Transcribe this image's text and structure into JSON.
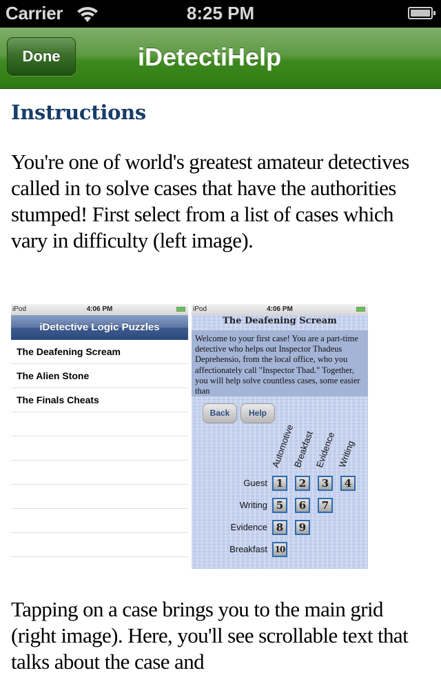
{
  "status_bar": {
    "carrier": "Carrier",
    "time": "8:25 PM",
    "wifi_icon": "wifi-icon",
    "battery_icon": "battery-icon"
  },
  "nav": {
    "done_label": "Done",
    "title": "iDetectiHelp"
  },
  "content": {
    "heading": "Instructions",
    "paragraph1": "You're one of world's greatest amateur detectives called in to solve cases that have the authorities stumped! First select from a list of cases which vary in difficulty (left image).",
    "paragraph2": "Tapping on a case brings you to the main grid (right image). Here, you'll see scrollable text that talks about the case and"
  },
  "left_image": {
    "status": {
      "carrier": "iPod",
      "time": "4:06 PM"
    },
    "title": "iDetective Logic Puzzles",
    "cases": [
      "The Deafening Scream",
      "The Alien Stone",
      "The Finals Cheats"
    ],
    "empty_rows": 6
  },
  "right_image": {
    "status": {
      "carrier": "iPod",
      "time": "4:06 PM"
    },
    "case_title": "The Deafening Scream",
    "case_text": "Welcome to your first case! You are a part-time detective who helps out Inspector Thadeus Deprehensio, from the local office, who you affectionately call \"Inspector Thad.\" Together, you will help solve countless cases, some easier than",
    "buttons": {
      "back": "Back",
      "help": "Help"
    },
    "columns": [
      "Automotive",
      "Breakfast",
      "Evidence",
      "Writing"
    ],
    "rows": [
      {
        "label": "Guest",
        "cells": [
          "1",
          "2",
          "3",
          "4"
        ]
      },
      {
        "label": "Writing",
        "cells": [
          "5",
          "6",
          "7"
        ]
      },
      {
        "label": "Evidence",
        "cells": [
          "8",
          "9"
        ]
      },
      {
        "label": "Breakfast",
        "cells": [
          "10"
        ]
      }
    ]
  }
}
